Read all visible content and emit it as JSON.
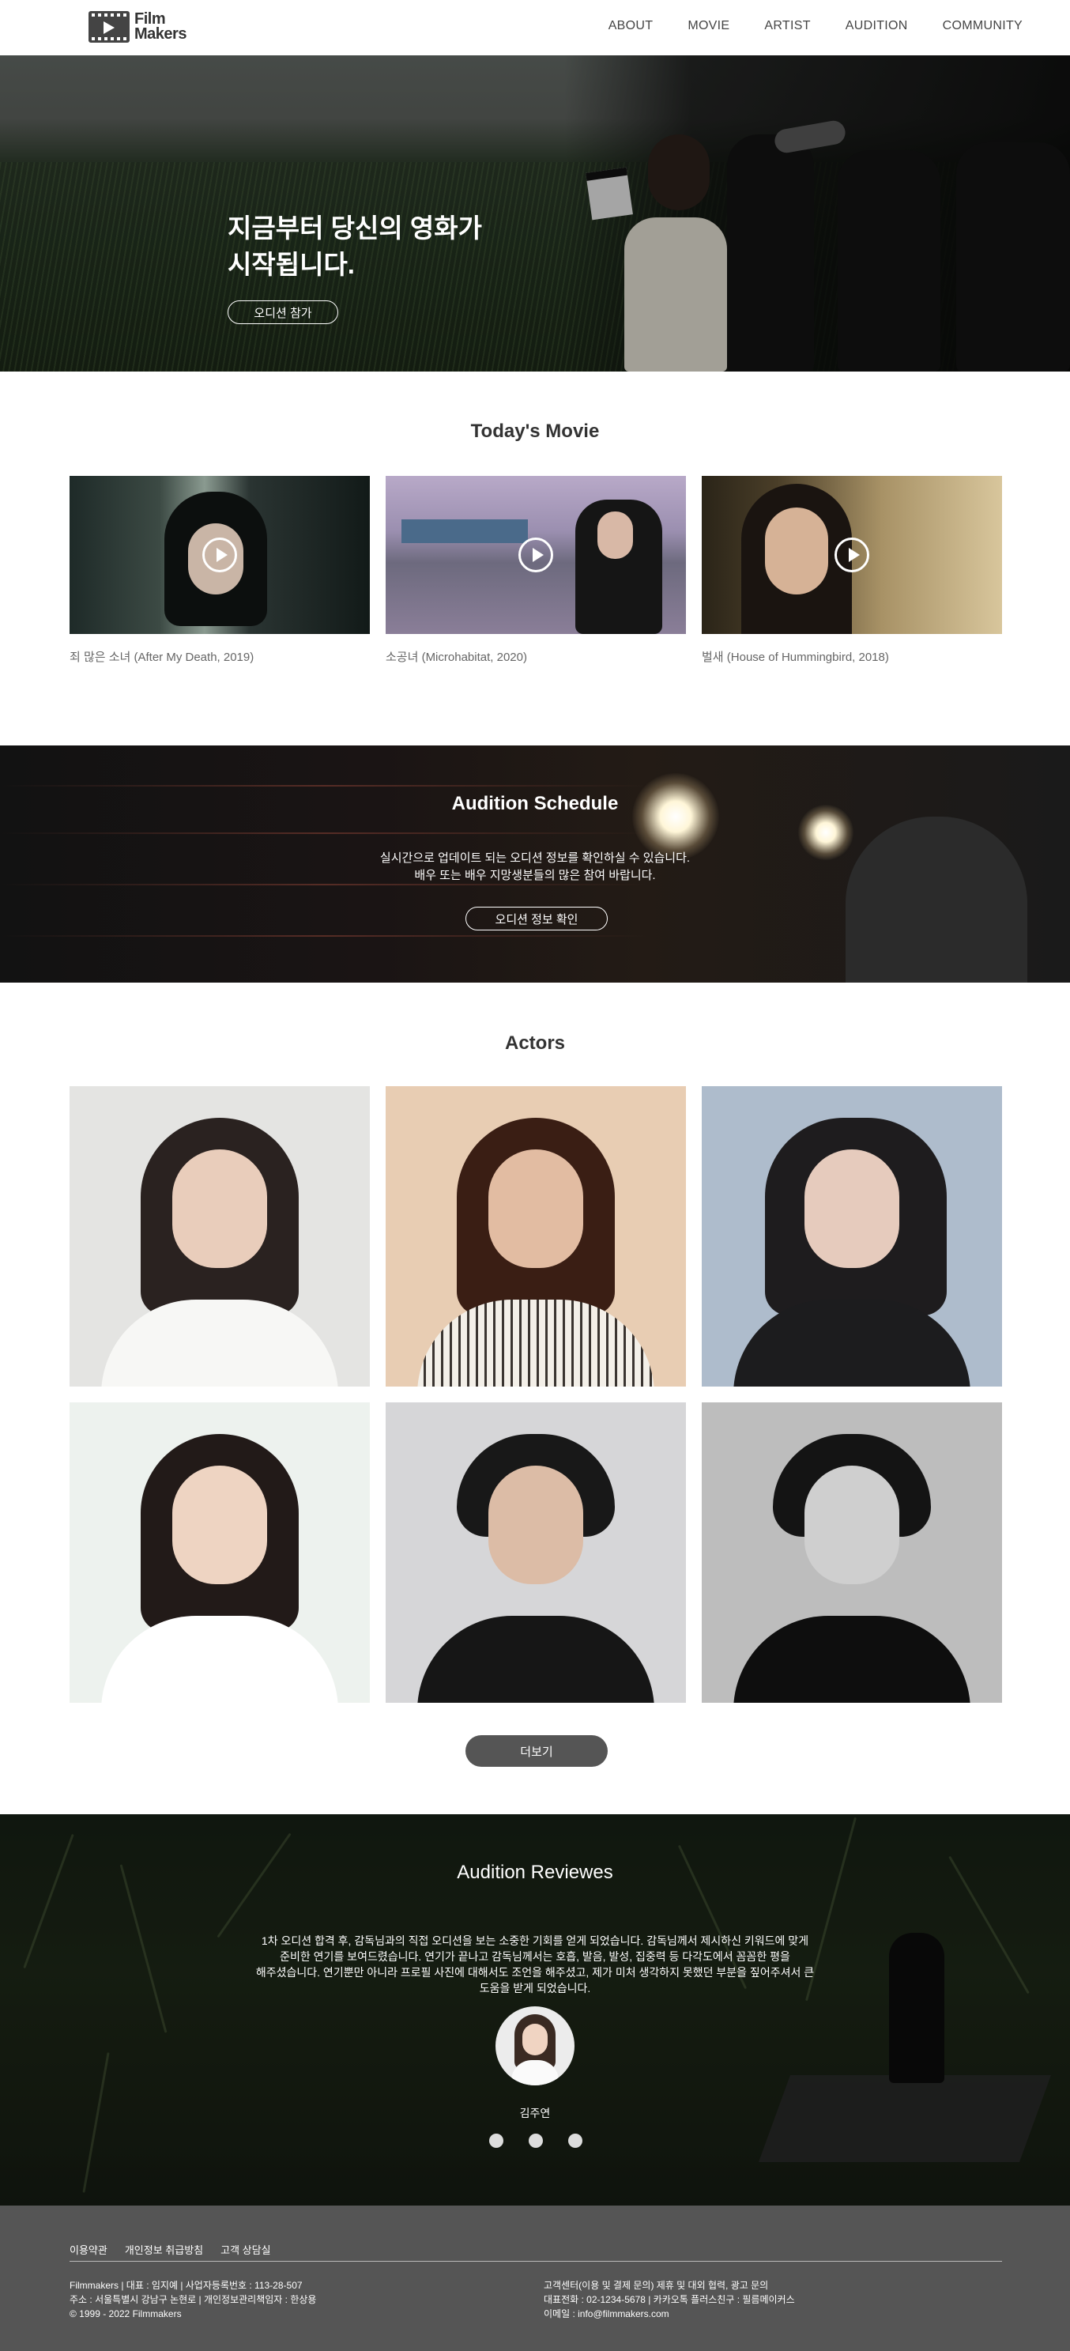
{
  "brand": {
    "line1": "Film",
    "line2": "Makers",
    "logo_icon": "film-play-icon"
  },
  "nav": [
    "ABOUT",
    "MOVIE",
    "ARTIST",
    "AUDITION",
    "COMMUNITY"
  ],
  "hero": {
    "title_line1": "지금부터 당신의 영화가",
    "title_line2": "시작됩니다.",
    "button": "오디션 참가"
  },
  "todays_movie": {
    "title": "Today's Movie",
    "movies": [
      {
        "caption": "죄 많은 소녀 (After My Death, 2019)"
      },
      {
        "caption": "소공녀 (Microhabitat, 2020)"
      },
      {
        "caption": "벌새 (House of Hummingbird, 2018)"
      }
    ]
  },
  "schedule": {
    "title": "Audition Schedule",
    "line1": "실시간으로 업데이트 되는 오디션 정보를 확인하실 수 있습니다.",
    "line2": "배우 또는 배우 지망생분들의 많은 참여 바랍니다.",
    "button": "오디션 정보 확인"
  },
  "actors": {
    "title": "Actors",
    "more_button": "더보기"
  },
  "reviews": {
    "title": "Audition Reviewes",
    "text_lines": [
      "1차 오디션 합격 후, 감독님과의 직접 오디션을 보는 소중한 기회를 얻게 되었습니다. 감독님께서 제시하신 키워드에 맞게",
      "준비한 연기를 보여드렸습니다. 연기가 끝나고 감독님께서는 호흡, 발음, 발성, 집중력 등 다각도에서 꼼꼼한 평을",
      "해주셨습니다. 연기뿐만 아니라 프로필 사진에 대해서도 조언을 해주셨고, 제가 미처 생각하지 못했던 부분을 짚어주셔서 큰",
      "도움을 받게 되었습니다."
    ],
    "name": "김주연"
  },
  "footer": {
    "links": [
      "이용약관",
      "개인정보 취급방침",
      "고객 상담실"
    ],
    "left_lines": [
      "Filmmakers | 대표 : 임지예 | 사업자등록번호 : 113-28-507",
      "주소 : 서울특별시 강남구 논현로 | 개인정보관리책임자 : 한상용",
      "© 1999 - 2022 Filmmakers"
    ],
    "right_lines": [
      "고객센터(이용 및 결제 문의) 제휴 및 대외 협력, 광고 문의",
      "대표전화 : 02-1234-5678 | 카카오톡 플러스친구 : 필름메이커스",
      "이메일 : info@filmmakers.com"
    ]
  },
  "colors": {
    "footer_bg": "#555555",
    "more_button_bg": "#555555",
    "text_dark": "#333333"
  }
}
